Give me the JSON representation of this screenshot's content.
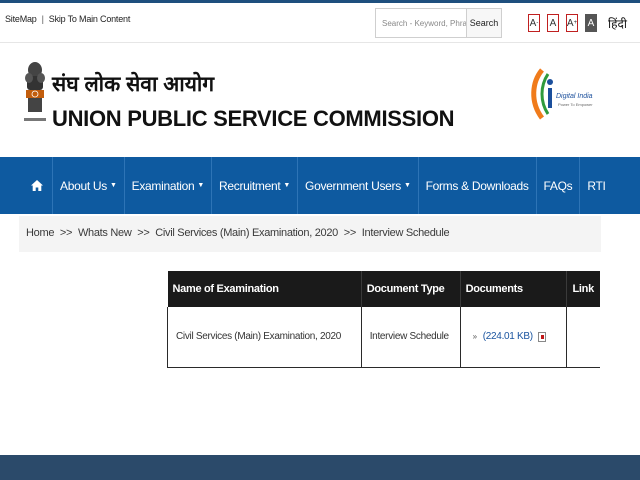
{
  "top_links": {
    "sitemap": "SiteMap",
    "separator": "|",
    "skip": "Skip To Main Content"
  },
  "search": {
    "placeholder": "Search - Keyword, Phrase",
    "button_label": "Search"
  },
  "font_controls": {
    "decrease": "A",
    "normal": "A",
    "increase": "A",
    "contrast": "A",
    "decrease_sup": "-",
    "increase_sup": "+"
  },
  "language_link": "हिंदी",
  "org": {
    "hindi_name": "संघ लोक सेवा आयोग",
    "english_name": "UNION PUBLIC SERVICE COMMISSION",
    "emblem_caption": "सत्यमेव जयते"
  },
  "digital_india": {
    "title": "Digital India",
    "tagline": "Power To Empower"
  },
  "nav": {
    "home_icon": "home-icon",
    "items": [
      {
        "label": "About Us",
        "dropdown": true
      },
      {
        "label": "Examination",
        "dropdown": true
      },
      {
        "label": "Recruitment",
        "dropdown": true
      },
      {
        "label": "Government Users",
        "dropdown": true
      },
      {
        "label": "Forms & Downloads",
        "dropdown": false
      },
      {
        "label": "FAQs",
        "dropdown": false
      },
      {
        "label": "RTI",
        "dropdown": false
      }
    ],
    "caret": "▼"
  },
  "breadcrumb": {
    "items": [
      "Home",
      "Whats New",
      "Civil Services (Main) Examination, 2020",
      "Interview Schedule"
    ],
    "separator": ">>"
  },
  "table": {
    "headers": [
      "Name of Examination",
      "Document Type",
      "Documents",
      "Link"
    ],
    "rows": [
      {
        "name": "Civil Services (Main) Examination, 2020",
        "type": "Interview Schedule",
        "document": "(224.01 KB)",
        "bullet": "»",
        "link": ""
      }
    ]
  },
  "colors": {
    "nav_bg": "#0e5aa0",
    "footer_bg": "#2b4a6a",
    "header_row_bg": "#1a1a1a",
    "link": "#1b55a0"
  }
}
